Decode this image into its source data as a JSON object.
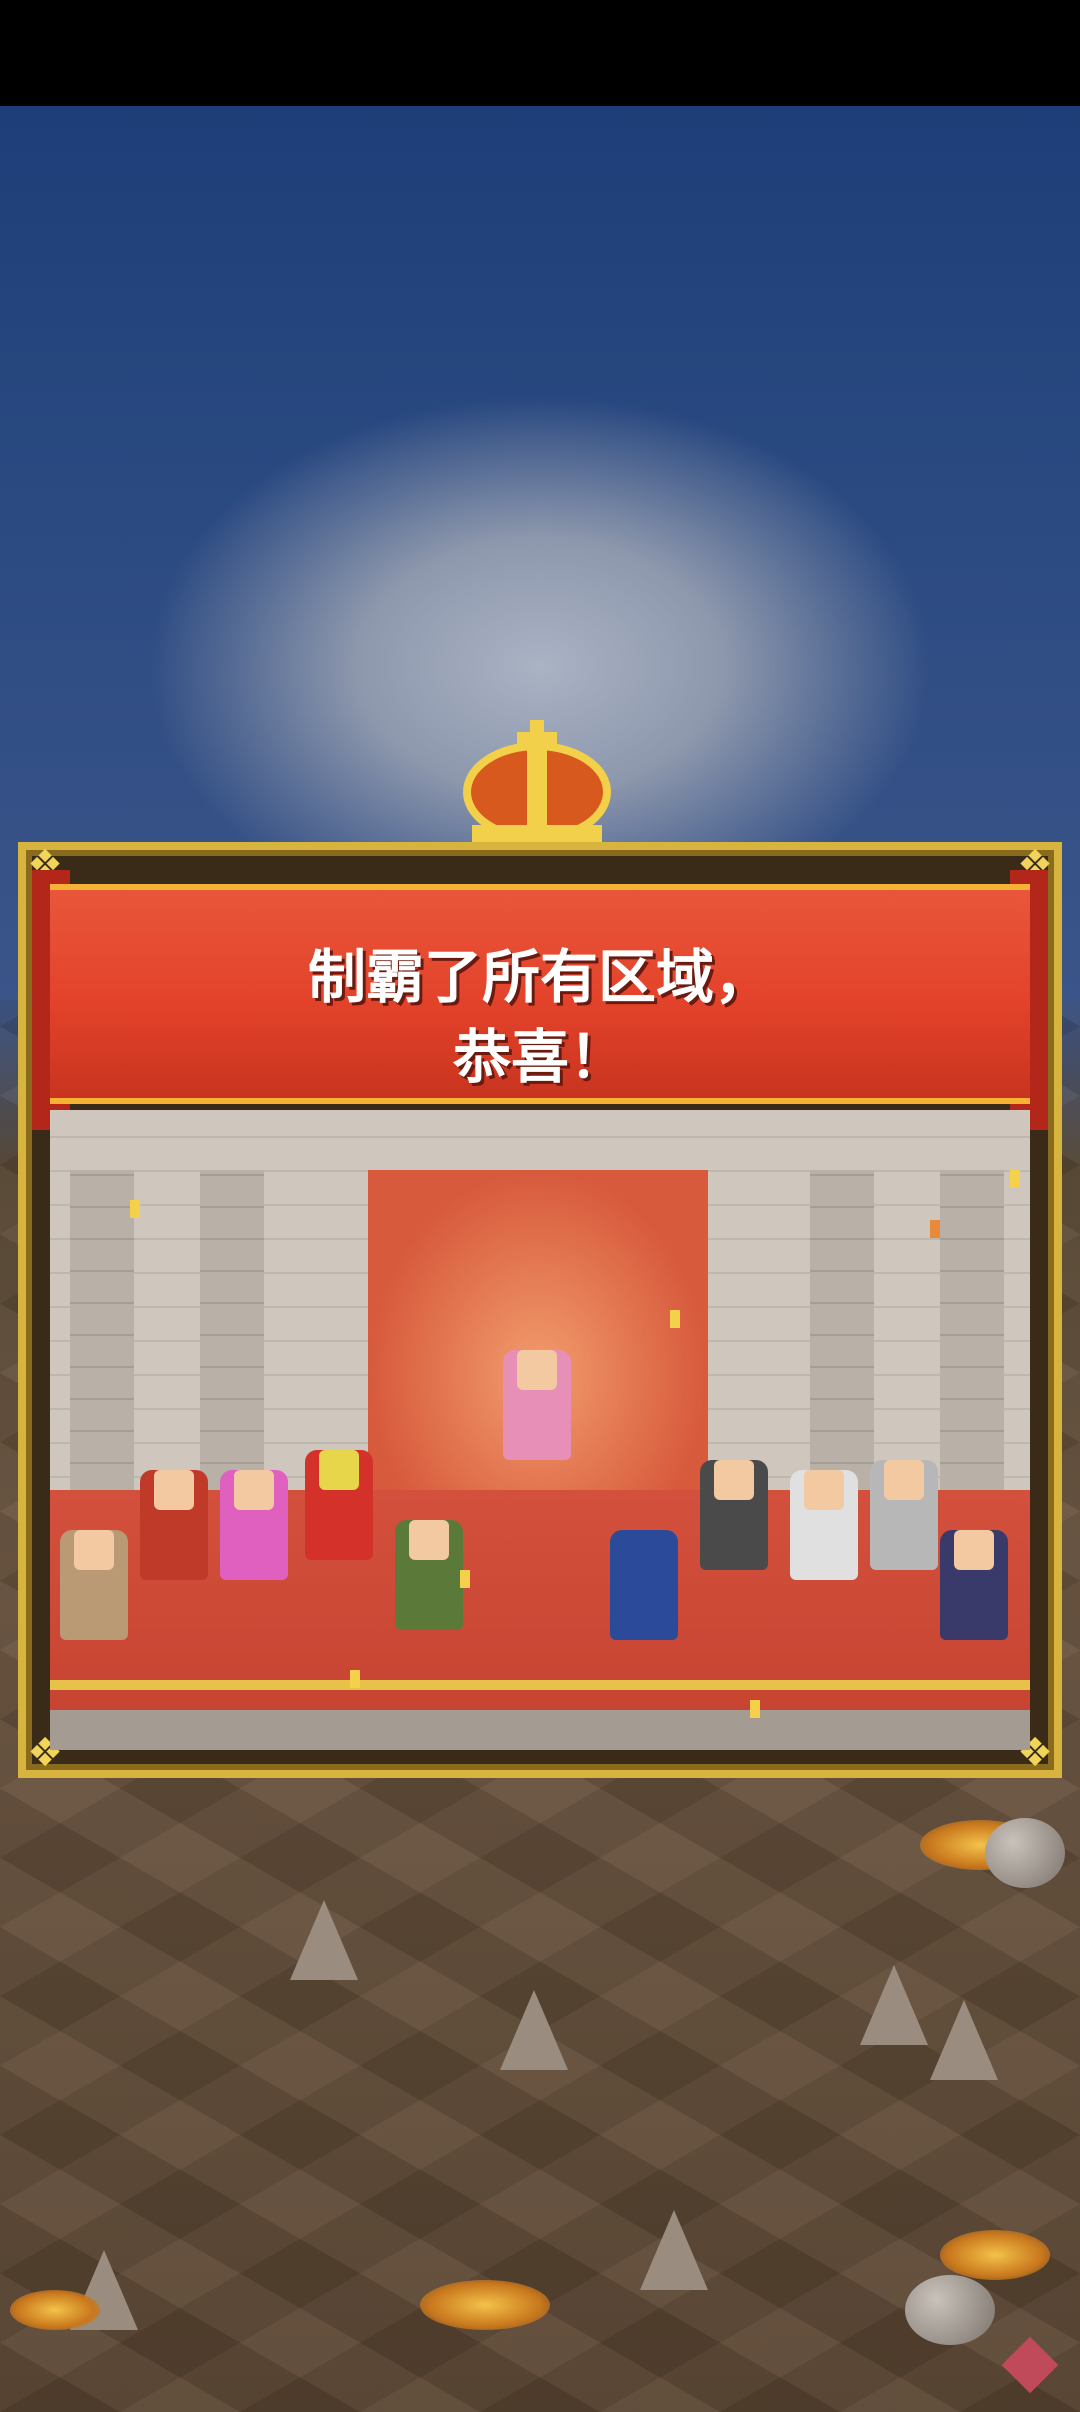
{
  "banner": {
    "line1": "制霸了所有区域，",
    "line2": "恭喜！"
  },
  "colors": {
    "banner_red": "#e3422a",
    "frame_gold": "#d6b43d",
    "sky_blue": "#2b4a82",
    "ground_brown": "#6b5540"
  }
}
